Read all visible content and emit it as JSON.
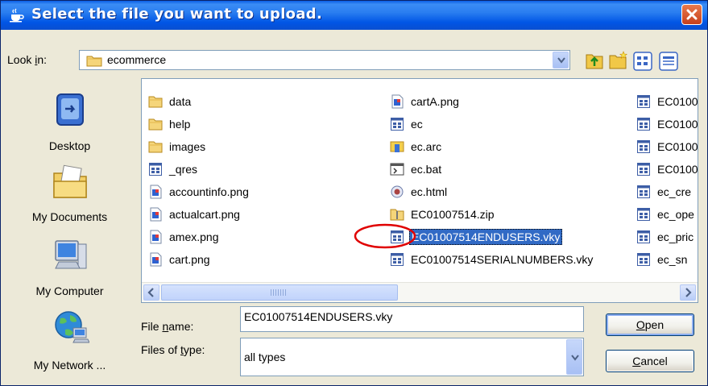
{
  "window": {
    "title": "Select the file you want to upload.",
    "title_icon": "java-coffee-icon",
    "close_icon": "close-icon"
  },
  "lookin": {
    "label": "Look in:",
    "value": "ecommerce",
    "folder_icon": "folder-icon"
  },
  "toolbar": [
    {
      "name": "up-one-level-icon"
    },
    {
      "name": "new-folder-icon"
    },
    {
      "name": "list-view-icon"
    },
    {
      "name": "details-view-icon"
    }
  ],
  "places": [
    {
      "label": "Desktop",
      "icon": "desktop-icon"
    },
    {
      "label": "My Documents",
      "icon": "my-documents-icon"
    },
    {
      "label": "My Computer",
      "icon": "my-computer-icon"
    },
    {
      "label": "My Network ...",
      "icon": "my-network-icon"
    }
  ],
  "files": {
    "col1": [
      {
        "name": "data",
        "icon": "folder"
      },
      {
        "name": "help",
        "icon": "folder"
      },
      {
        "name": "images",
        "icon": "folder"
      },
      {
        "name": "_qres",
        "icon": "generic"
      },
      {
        "name": "accountinfo.png",
        "icon": "image"
      },
      {
        "name": "actualcart.png",
        "icon": "image"
      },
      {
        "name": "amex.png",
        "icon": "image"
      },
      {
        "name": "cart.png",
        "icon": "image"
      }
    ],
    "col2": [
      {
        "name": "cartA.png",
        "icon": "image"
      },
      {
        "name": "ec",
        "icon": "generic"
      },
      {
        "name": "ec.arc",
        "icon": "archive"
      },
      {
        "name": "ec.bat",
        "icon": "batch"
      },
      {
        "name": "ec.html",
        "icon": "html"
      },
      {
        "name": "EC01007514.zip",
        "icon": "zip"
      },
      {
        "name": "EC01007514ENDUSERS.vky",
        "icon": "generic",
        "selected": true
      },
      {
        "name": "EC01007514SERIALNUMBERS.vky",
        "icon": "generic"
      }
    ],
    "col3": [
      {
        "name": "EC0100",
        "icon": "generic"
      },
      {
        "name": "EC0100",
        "icon": "generic"
      },
      {
        "name": "EC0100",
        "icon": "generic"
      },
      {
        "name": "EC0100",
        "icon": "generic"
      },
      {
        "name": "ec_cre",
        "icon": "generic"
      },
      {
        "name": "ec_ope",
        "icon": "generic"
      },
      {
        "name": "ec_pric",
        "icon": "generic"
      },
      {
        "name": "ec_sn",
        "icon": "generic"
      }
    ]
  },
  "filename": {
    "label_pre": "File ",
    "label_u": "n",
    "label_post": "ame:",
    "value": "EC01007514ENDUSERS.vky"
  },
  "filetype": {
    "label_pre": "Files of ",
    "label_u": "t",
    "label_post": "ype:",
    "value": "all types"
  },
  "buttons": {
    "open_u": "O",
    "open_rest": "pen",
    "cancel_u": "C",
    "cancel_rest": "ancel"
  },
  "colors": {
    "title_bar": "#0055e5",
    "selection": "#316ac5",
    "highlight_circle": "#e00000"
  }
}
